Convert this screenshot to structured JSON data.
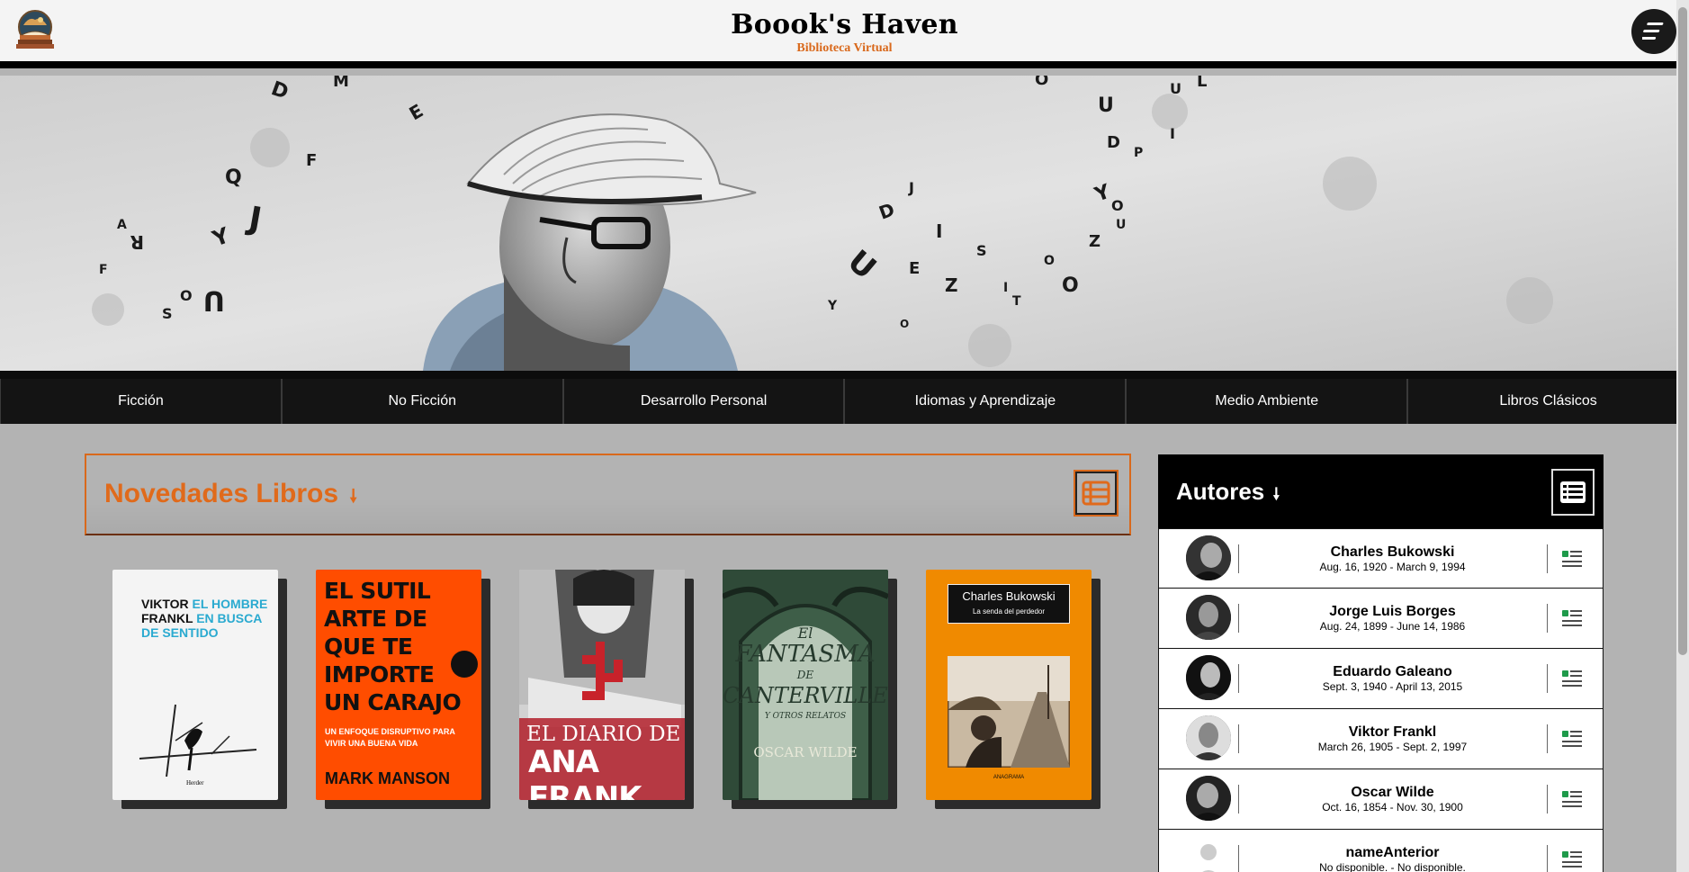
{
  "header": {
    "title": "Boook's Haven",
    "subtitle": "Biblioteca Virtual",
    "logo_icon": "book-logo-icon",
    "menu_icon": "hamburger-menu-icon"
  },
  "hero": {
    "description_icon": "hero-banner-image"
  },
  "categories": [
    {
      "label": "Ficción"
    },
    {
      "label": "No Ficción"
    },
    {
      "label": "Desarrollo Personal"
    },
    {
      "label": "Idiomas y Aprendizaje"
    },
    {
      "label": "Medio Ambiente"
    },
    {
      "label": "Libros Clásicos"
    }
  ],
  "novedades": {
    "title": "Novedades Libros",
    "arrow": "🠗",
    "list_icon": "list-view-icon",
    "books": [
      {
        "line1": "VIKTOR",
        "line1b": "EL HOMBRE",
        "line2": "FRANKL",
        "line2b": "EN BUSCA",
        "line3": "DE SENTIDO",
        "publisher": "Herder"
      },
      {
        "title": "EL SUTIL ARTE DE QUE TE IMPORTE UN CARAJO",
        "subtitle": "UN ENFOQUE DISRUPTIVO PARA VIVIR UNA BUENA VIDA",
        "author": "MARK MANSON"
      },
      {
        "title1": "EL DIARIO DE",
        "title2": "ANA FRANK"
      },
      {
        "title1": "El",
        "title2": "FANTASMA",
        "title3": "DE",
        "title4": "CANTERVILLE",
        "subtitle": "Y OTROS RELATOS",
        "author": "OSCAR WILDE"
      },
      {
        "author": "Charles Bukowski",
        "title": "La senda del perdedor",
        "publisher": "ANAGRAMA"
      }
    ]
  },
  "autores": {
    "title": "Autores",
    "arrow": "🠗",
    "list_icon": "list-view-icon",
    "items": [
      {
        "name": "Charles Bukowski",
        "dates": "Aug. 16, 1920 - March 9, 1994"
      },
      {
        "name": "Jorge Luis Borges",
        "dates": "Aug. 24, 1899 - June 14, 1986"
      },
      {
        "name": "Eduardo Galeano",
        "dates": "Sept. 3, 1940 - April 13, 2015"
      },
      {
        "name": "Viktor Frankl",
        "dates": "March 26, 1905 - Sept. 2, 1997"
      },
      {
        "name": "Oscar Wilde",
        "dates": "Oct. 16, 1854 - Nov. 30, 1900"
      },
      {
        "name": "nameAnterior",
        "dates": "No disponible. - No disponible."
      }
    ]
  },
  "colors": {
    "accent": "#d9691c",
    "nav_bg": "#141414",
    "page_bg": "#b3b3b3"
  }
}
